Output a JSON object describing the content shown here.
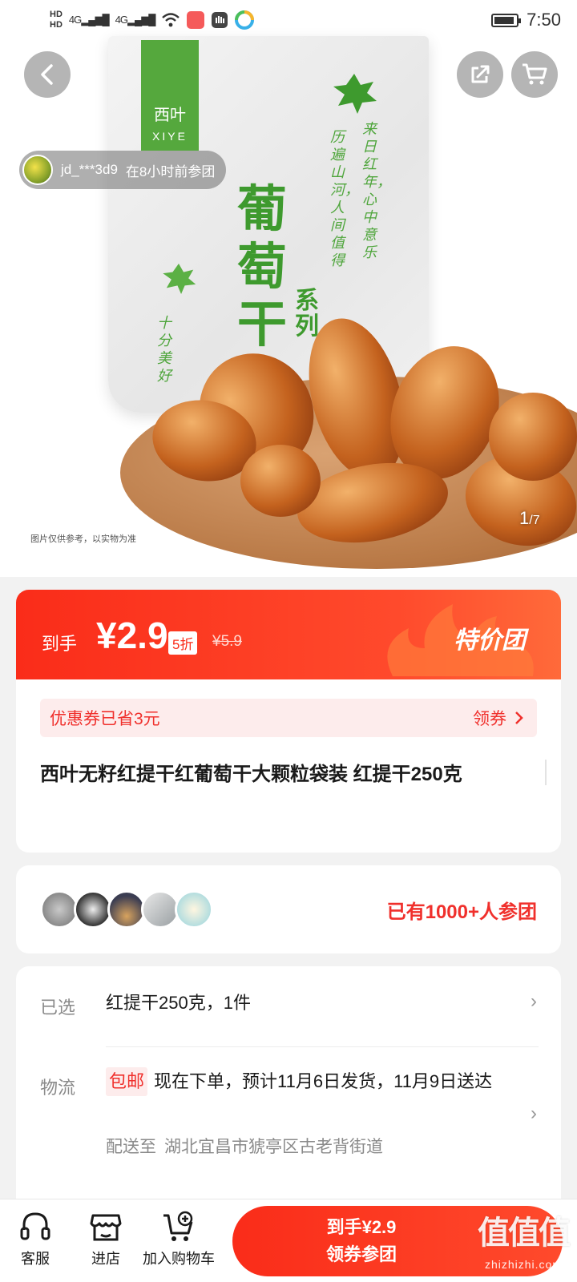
{
  "status_bar": {
    "hd1": "HD",
    "hd2": "HD",
    "signal1": "4G",
    "signal2": "4G",
    "time": "7:50"
  },
  "hero": {
    "brand_cn": "西叶",
    "brand_en": "XIYE",
    "char1": "葡",
    "char2": "萄",
    "char3": "干",
    "series": "系列",
    "poem1": "来日红年，心中意乐",
    "poem2": "历遍山河，人间值得",
    "poem3": "十分美好",
    "note": "图片仅供参考，以实物为准",
    "counter_current": "1",
    "counter_total": "/7"
  },
  "participant": {
    "user": "jd_***3d9",
    "action": "在8小时前参团"
  },
  "price": {
    "label": "到手",
    "value": "¥2.9",
    "discount": "5折",
    "original": "¥5.9",
    "badge": "特价团"
  },
  "coupon": {
    "text": "优惠券已省3元",
    "action": "领券"
  },
  "product": {
    "title": "西叶无籽红提干红葡萄干大颗粒袋装 红提干250克"
  },
  "group": {
    "count_text": "已有1000+人参团"
  },
  "details": {
    "selected_label": "已选",
    "selected_value": "红提干250克，1件",
    "logistics_label": "物流",
    "free_shipping": "包邮",
    "logistics_value": "现在下单，预计11月6日发货，11月9日送达",
    "ship_to_label": "配送至",
    "ship_to": "湖北宜昌市猇亭区古老背街道"
  },
  "bottom_bar": {
    "service": "客服",
    "store": "进店",
    "add_cart": "加入购物车",
    "cta_price": "到手¥2.9",
    "cta_action": "领券参团"
  },
  "watermark": {
    "logo": "值值值",
    "url": "zhizhizhi.com"
  },
  "colors": {
    "accent": "#fa2c19",
    "brand_green": "#55a83d"
  }
}
